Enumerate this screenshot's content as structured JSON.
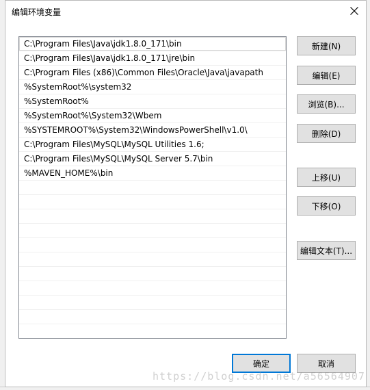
{
  "dialog": {
    "title": "编辑环境变量"
  },
  "path_entries": [
    "C:\\Program Files\\Java\\jdk1.8.0_171\\bin",
    "C:\\Program Files\\Java\\jdk1.8.0_171\\jre\\bin",
    "C:\\Program Files (x86)\\Common Files\\Oracle\\Java\\javapath",
    "%SystemRoot%\\system32",
    "%SystemRoot%",
    "%SystemRoot%\\System32\\Wbem",
    "%SYSTEMROOT%\\System32\\WindowsPowerShell\\v1.0\\",
    "C:\\Program Files\\MySQL\\MySQL Utilities 1.6;",
    "C:\\Program Files\\MySQL\\MySQL Server 5.7\\bin",
    "%MAVEN_HOME%\\bin"
  ],
  "buttons": {
    "new": "新建(N)",
    "edit": "编辑(E)",
    "browse": "浏览(B)...",
    "delete": "删除(D)",
    "move_up": "上移(U)",
    "move_down": "下移(O)",
    "edit_text": "编辑文本(T)...",
    "ok": "确定",
    "cancel": "取消"
  },
  "watermark": "https://blog.csdn.net/a56564907",
  "colors": {
    "accent": "#0078d7",
    "button_bg": "#e1e1e1",
    "list_border": "#828790"
  }
}
